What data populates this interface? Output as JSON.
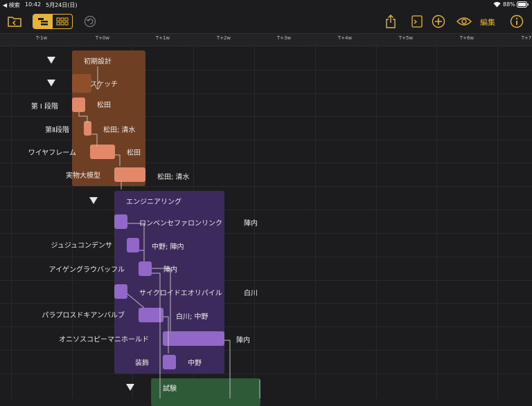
{
  "status": {
    "back": "◀ 検索",
    "time": "10:42",
    "date": "5月24日(日)",
    "battery": "88%"
  },
  "toolbar": {
    "edit_label": "編集"
  },
  "timeline": [
    "T-1w",
    "T+0w",
    "T+1w",
    "T+2w",
    "T+3w",
    "T+4w",
    "T+5w",
    "T+6w",
    "T+7"
  ],
  "colors": {
    "design": "#6e3f23",
    "design_task": "#e3896a",
    "engineering": "#3c2a5c",
    "engineering_task": "#9167c8",
    "test": "#2f5a37"
  },
  "groups": {
    "design": "初期設計",
    "engineering": "エンジニアリング",
    "test": "試験"
  },
  "tasks": {
    "sketch": "スケッチ",
    "phase1": {
      "name": "第 Ⅰ 段階",
      "res": "松田"
    },
    "phase2": {
      "name": "第Ⅱ段階",
      "res": "松田; 清水"
    },
    "wireframe": {
      "name": "ワイヤフレーム",
      "res": "松田"
    },
    "mockup": {
      "name": "実物大模型",
      "res": "松田; 清水"
    },
    "e1": {
      "name": "ロンベンセファロンリンク",
      "res": "陣内"
    },
    "e2": {
      "name": "ジュジュコンデンサ",
      "res": "中野; 陣内"
    },
    "e3": {
      "name": "アイゲングラウバッフル",
      "res": "陣内"
    },
    "e4": {
      "name": "サイクロイドエオリパイル",
      "res": "白川"
    },
    "e5": {
      "name": "パラプロスドキアンバルブ",
      "res": "白川; 中野"
    },
    "e6": {
      "name": "オニソスコピーマニホールド",
      "res": "陣内"
    },
    "e7": {
      "name": "装飾",
      "res": "中野"
    }
  }
}
